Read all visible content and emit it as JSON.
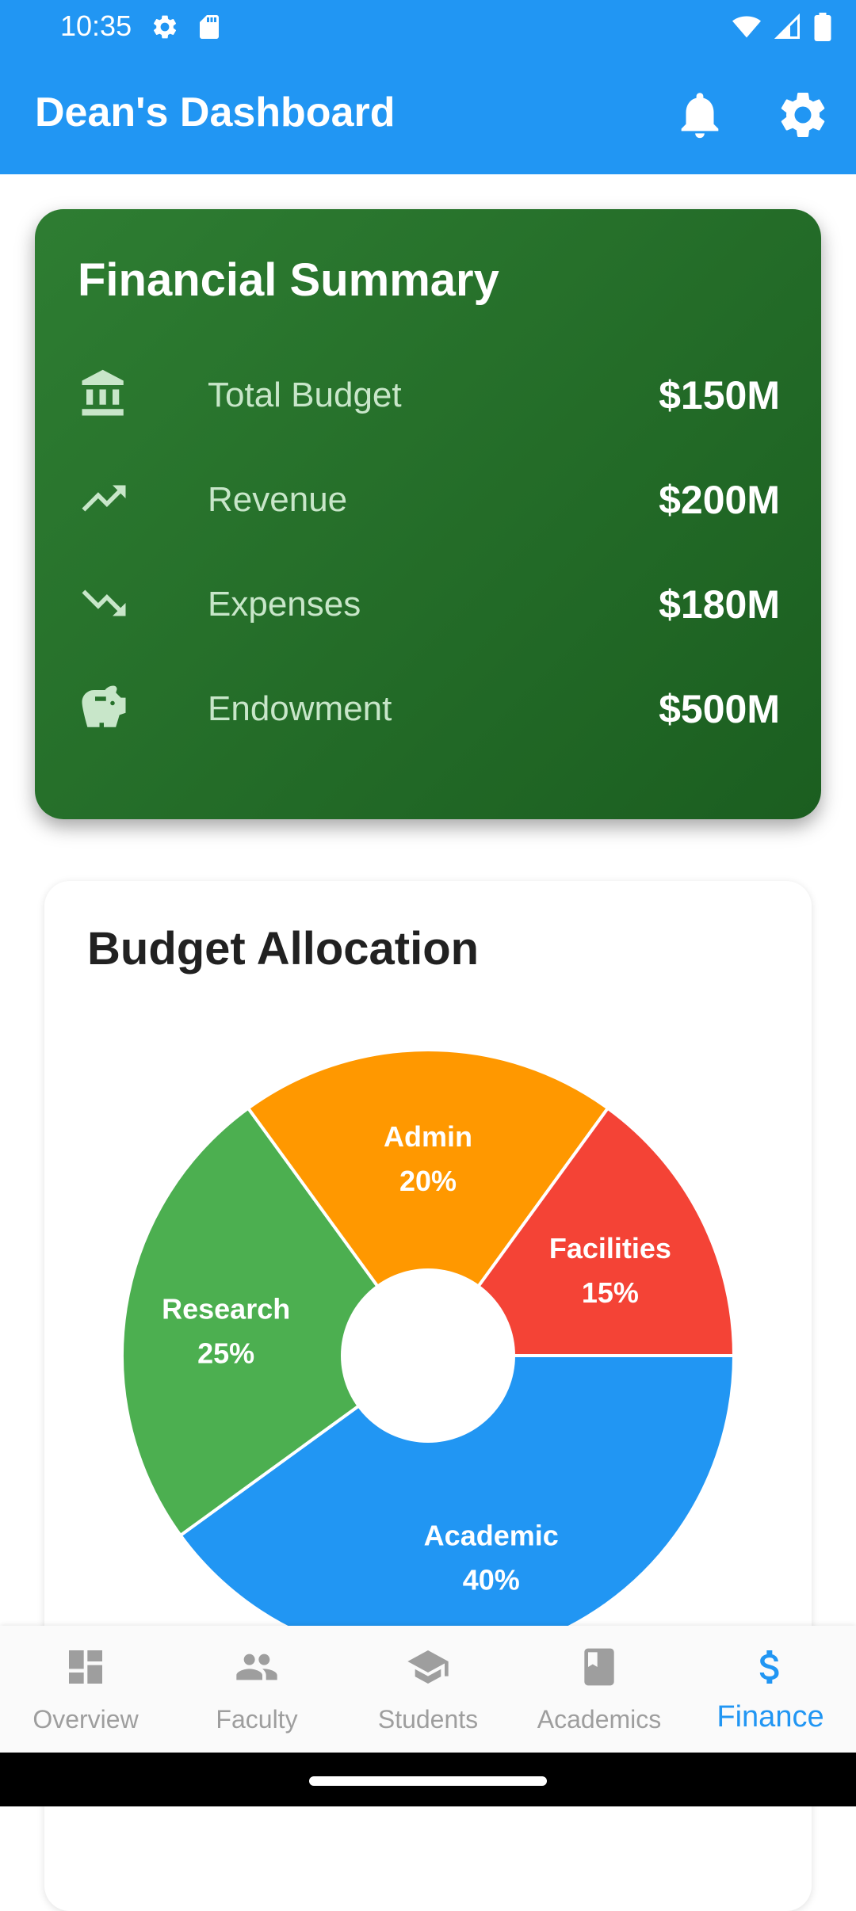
{
  "status_bar": {
    "time": "10:35",
    "left_icons": [
      "gear-icon",
      "sd-card-icon"
    ],
    "right_icons": [
      "wifi-icon",
      "signal-icon",
      "battery-icon"
    ]
  },
  "app_bar": {
    "title": "Dean's Dashboard",
    "actions": [
      "bell-icon",
      "gear-icon"
    ],
    "color": "#2196F3"
  },
  "financial_summary": {
    "title": "Financial Summary",
    "rows": [
      {
        "icon": "bank-icon",
        "label": "Total Budget",
        "value": "$150M"
      },
      {
        "icon": "trending-up-icon",
        "label": "Revenue",
        "value": "$200M"
      },
      {
        "icon": "trending-down-icon",
        "label": "Expenses",
        "value": "$180M"
      },
      {
        "icon": "piggy-bank-icon",
        "label": "Endowment",
        "value": "$500M"
      }
    ],
    "gradient": [
      "#2E7D32",
      "#1B5E20"
    ]
  },
  "budget_allocation": {
    "title": "Budget Allocation"
  },
  "chart_data": {
    "type": "pie",
    "categories": [
      "Academic",
      "Research",
      "Admin",
      "Facilities"
    ],
    "values": [
      40,
      25,
      20,
      15
    ],
    "labels": [
      "40%",
      "25%",
      "20%",
      "15%"
    ],
    "colors": [
      "#2196F3",
      "#4CAF50",
      "#FF9800",
      "#F44336"
    ],
    "donut_hole": true
  },
  "bottom_nav": {
    "items": [
      {
        "icon": "dashboard-icon",
        "label": "Overview",
        "active": false
      },
      {
        "icon": "people-icon",
        "label": "Faculty",
        "active": false
      },
      {
        "icon": "school-icon",
        "label": "Students",
        "active": false
      },
      {
        "icon": "book-icon",
        "label": "Academics",
        "active": false
      },
      {
        "icon": "dollar-icon",
        "label": "Finance",
        "active": true
      }
    ],
    "active_color": "#2196F3",
    "inactive_color": "#9E9E9E"
  }
}
